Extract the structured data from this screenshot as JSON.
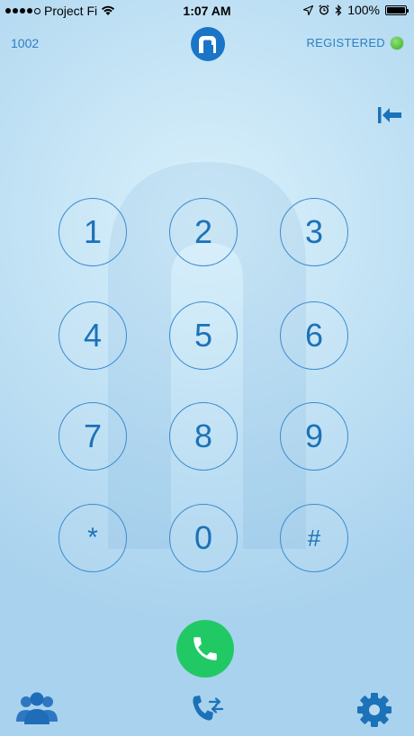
{
  "status_bar": {
    "carrier": "Project Fi",
    "time": "1:07 AM",
    "battery": "100%"
  },
  "header": {
    "extension": "1002",
    "registration_status": "REGISTERED",
    "status_color": "#38b01e"
  },
  "keypad": {
    "keys": [
      "1",
      "2",
      "3",
      "4",
      "5",
      "6",
      "7",
      "8",
      "9",
      "*",
      "0",
      "#"
    ]
  },
  "icons": {
    "back": "backspace-arrow-icon",
    "call": "phone-icon",
    "contacts": "contacts-icon",
    "transfer": "call-transfer-icon",
    "settings": "gear-icon"
  },
  "colors": {
    "accent": "#1c72b8",
    "call": "#21c965"
  }
}
